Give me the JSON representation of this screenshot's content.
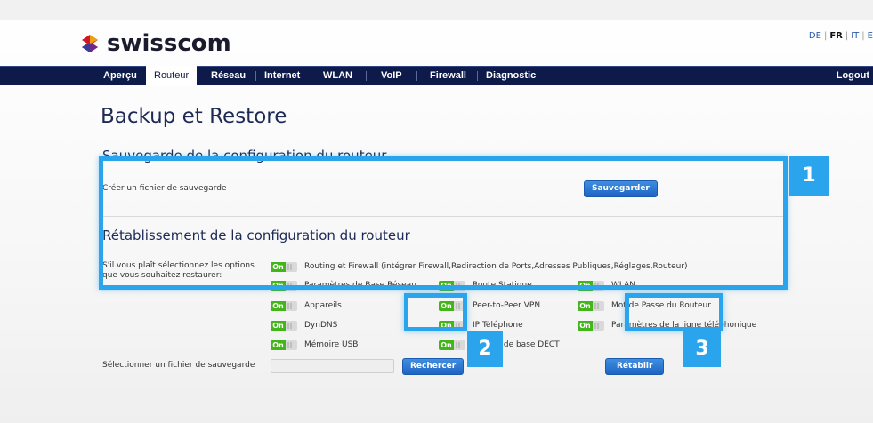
{
  "brand": {
    "name": "swisscom"
  },
  "languages": {
    "de": "DE",
    "fr": "FR",
    "it": "IT",
    "en": "E"
  },
  "nav": {
    "items": [
      "Aperçu",
      "Routeur",
      "Réseau",
      "Internet",
      "WLAN",
      "VoIP",
      "Firewall",
      "Diagnostic"
    ],
    "active": "Routeur",
    "logout": "Logout"
  },
  "page": {
    "title": "Backup et Restore"
  },
  "backup": {
    "heading": "Sauvegarde de la configuration du routeur",
    "create_label": "Créer un fichier de sauvegarde",
    "save_button": "Sauvegarder"
  },
  "restore": {
    "heading": "Rétablissement de la configuration du routeur",
    "instruction_line1": "S'il vous plaît sélectionnez les options",
    "instruction_line2": "que vous souhaitez restaurer:",
    "toggle_on_label": "On",
    "options": {
      "routing_firewall": "Routing et Firewall (intégrer Firewall,Redirection de Ports,Adresses Publiques,Réglages,Routeur)",
      "base_params": "Paramètres de Base Réseau",
      "static_route": "Route Statique",
      "wlan": "WLAN",
      "devices": "Appareils",
      "vpn": "Peer-to-Peer VPN",
      "router_password": "Mot de Passe du Routeur",
      "dyndns": "DynDNS",
      "ip_phone": "IP Téléphone",
      "phone_line_params": "Paramètres de la ligne téléphonique",
      "usb_memory": "Mémoire USB",
      "dect_base": "Station de base DECT"
    },
    "select_file_label": "Sélectionner un fichier de sauvegarde",
    "browse_button": "Rechercer",
    "restore_button": "Rétablir"
  },
  "callouts": {
    "one": "1",
    "two": "2",
    "three": "3"
  },
  "colors": {
    "nav_bg": "#0d1a4a",
    "highlight": "#2aa4ec",
    "toggle_on": "#42b51a",
    "button": "#1e64c2"
  }
}
